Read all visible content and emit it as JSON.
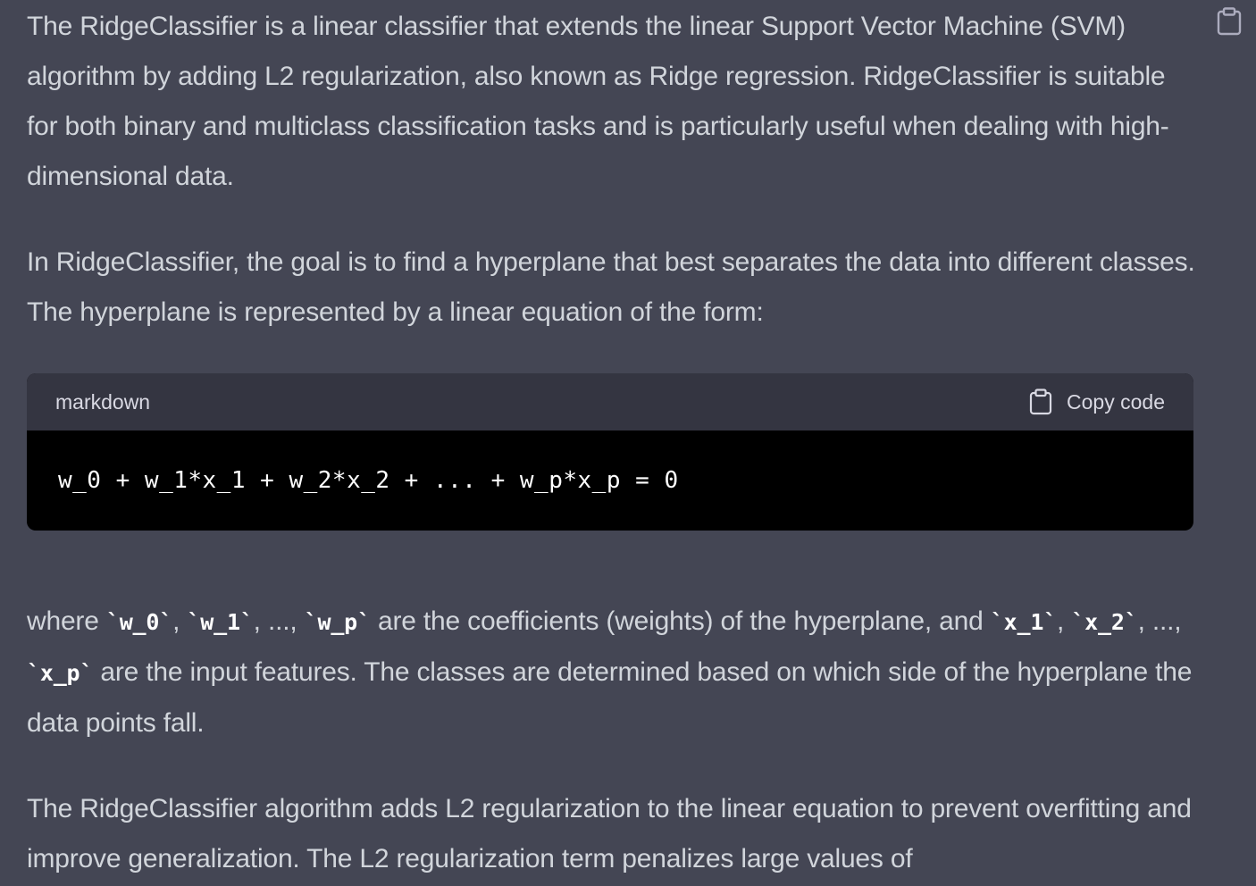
{
  "message": {
    "para1": "The RidgeClassifier is a linear classifier that extends the linear Support Vector Machine (SVM) algorithm by adding L2 regularization, also known as Ridge regression. RidgeClassifier is suitable for both binary and multiclass classification tasks and is particularly useful when dealing with high-dimensional data.",
    "para2": "In RidgeClassifier, the goal is to find a hyperplane that best separates the data into different classes. The hyperplane is represented by a linear equation of the form:",
    "para3": {
      "t0": "where ",
      "c0": "`w_0`",
      "t1": ", ",
      "c1": "`w_1`",
      "t2": ", ..., ",
      "c2": "`w_p`",
      "t3": " are the coefficients (weights) of the hyperplane, and ",
      "c3": "`x_1`",
      "t4": ", ",
      "c4": "`x_2`",
      "t5": ", ..., ",
      "c5": "`x_p`",
      "t6": " are the input features. The classes are determined based on which side of the hyperplane the data points fall."
    },
    "para4": "The RidgeClassifier algorithm adds L2 regularization to the linear equation to prevent overfitting and improve generalization. The L2 regularization term penalizes large values of"
  },
  "code_block": {
    "language": "markdown",
    "copy_label": "Copy code",
    "code": "w_0 + w_1*x_1 + w_2*x_2 + ... + w_p*x_p = 0"
  },
  "icons": {
    "top_copy": "clipboard-icon",
    "code_copy": "clipboard-icon"
  },
  "colors": {
    "background": "#444654",
    "text": "#d1d5db",
    "code_header": "#343541",
    "code_body": "#000000"
  }
}
